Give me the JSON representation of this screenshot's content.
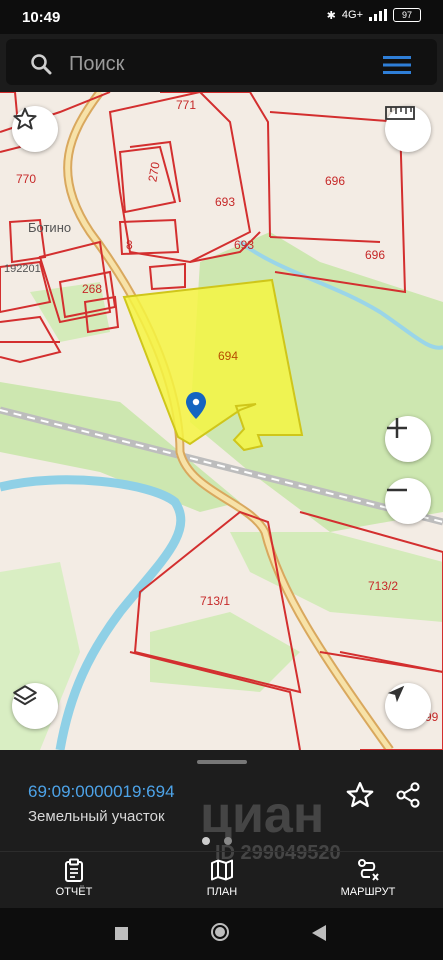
{
  "status": {
    "time": "10:49",
    "network": "4G+",
    "battery": "97"
  },
  "search": {
    "placeholder": "Поиск"
  },
  "map": {
    "labels": {
      "l771": "771",
      "l770": "770",
      "l270": "270",
      "l693a": "693",
      "l693b": "693",
      "l696a": "696",
      "l696b": "696",
      "l8": "8",
      "l268": "268",
      "l694": "694",
      "l7131": "713/1",
      "l7132": "713/2",
      "l99": "99",
      "village": "Ботино",
      "quarter": "192201"
    },
    "highlight_color": "#f5f542",
    "parcel_color": "#d32f2f"
  },
  "panel": {
    "cadastral_number": "69:09:0000019:694",
    "property_type": "Земельный участок",
    "watermark": "циан",
    "watermark_id": "ID 299049520",
    "page_indicator": {
      "total": 2,
      "active": 1
    }
  },
  "tabs": {
    "report": "ОТЧЁТ",
    "plan": "ПЛАН",
    "route": "МАРШРУТ"
  }
}
